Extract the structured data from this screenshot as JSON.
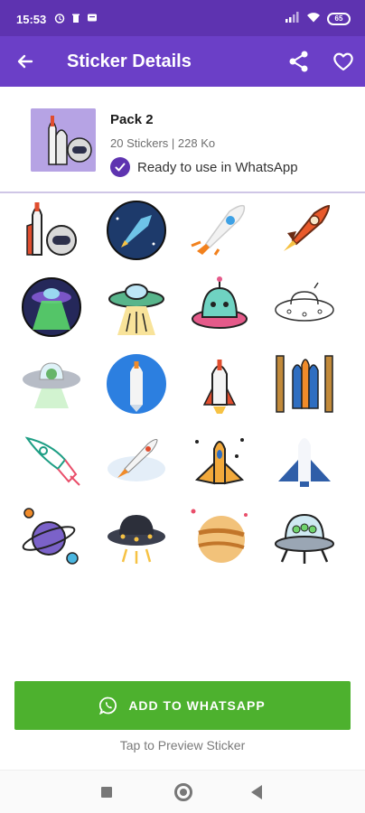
{
  "status_bar": {
    "time": "15:53",
    "battery": "65"
  },
  "app_bar": {
    "title": "Sticker Details",
    "back_icon": "arrow-left-icon",
    "share_icon": "share-icon",
    "favorite_icon": "heart-outline-icon"
  },
  "pack": {
    "name": "Pack 2",
    "meta": "20 Stickers | 228 Ko",
    "ready_text": "Ready to use in WhatsApp"
  },
  "stickers": [
    {
      "name": "space-shuttle-astronaut-sticker"
    },
    {
      "name": "rocket-circle-sticker"
    },
    {
      "name": "white-rocket-sticker"
    },
    {
      "name": "orange-rocket-sticker"
    },
    {
      "name": "ufo-beam-circle-sticker"
    },
    {
      "name": "ufo-beam-sticker"
    },
    {
      "name": "alien-ufo-sticker"
    },
    {
      "name": "ufo-outline-sticker"
    },
    {
      "name": "alien-saucer-sticker"
    },
    {
      "name": "shuttle-blue-circle-sticker"
    },
    {
      "name": "shuttle-launch-sticker"
    },
    {
      "name": "launch-tower-sticker"
    },
    {
      "name": "rocket-outline-sticker"
    },
    {
      "name": "rocket-clouds-sticker"
    },
    {
      "name": "orange-spaceship-sticker"
    },
    {
      "name": "space-shuttle-sticker"
    },
    {
      "name": "planet-ring-sticker"
    },
    {
      "name": "flying-saucer-sticker"
    },
    {
      "name": "striped-planet-sticker"
    },
    {
      "name": "ufo-lander-sticker"
    }
  ],
  "actions": {
    "add_label": "ADD TO WHATSAPP",
    "preview_hint": "Tap to Preview Sticker"
  },
  "colors": {
    "status_bar": "#5e33b0",
    "app_bar": "#6b3fc7",
    "accent": "#5e33b0",
    "add_button": "#4db12e"
  }
}
